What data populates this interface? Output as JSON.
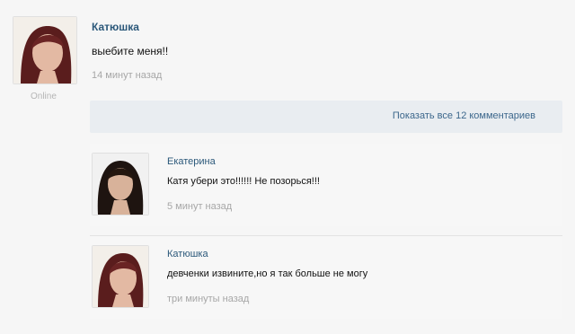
{
  "post": {
    "author": "Катюшка",
    "text": "выебите меня!!",
    "time": "14 минут назад",
    "status": "Online"
  },
  "show_all_label": "Показать все 12 комментариев",
  "comments": [
    {
      "author": "Екатерина",
      "text": "Катя убери это!!!!!! Не позорься!!!",
      "time": "5 минут назад"
    },
    {
      "author": "Катюшка",
      "text": "девченки извините,но я так больше не могу",
      "time": "три минуты назад"
    }
  ],
  "colors": {
    "author_link": "#2b587a",
    "show_all_bar": "#e9edf1",
    "timestamp": "#a7a7a7"
  }
}
